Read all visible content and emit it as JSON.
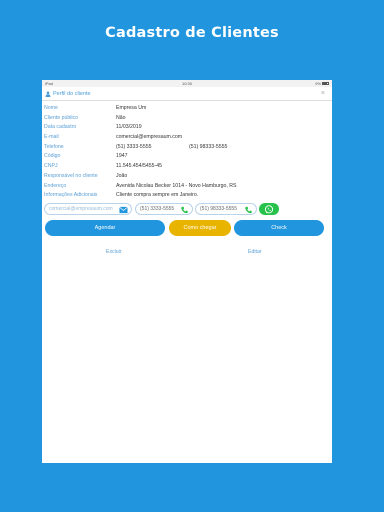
{
  "headline": "Cadastro de Clientes",
  "status_bar": {
    "carrier": "iPad",
    "time": "10:30",
    "battery": "9%"
  },
  "modal": {
    "title": "Perfil do cliente",
    "close_glyph": "×"
  },
  "fields": [
    {
      "label": "Nome",
      "value": "Empresa Um"
    },
    {
      "label": "Cliente público",
      "value": "Não"
    },
    {
      "label": "Data cadastro",
      "value": "11/03/2019"
    },
    {
      "label": "E-mail",
      "value": "comercial@empresaum.com"
    },
    {
      "label": "Telefone",
      "value": "(51) 3333-5555",
      "value2": "(51) 98333-5555"
    },
    {
      "label": "Código",
      "value": "1947"
    },
    {
      "label": "CNPJ",
      "value": "11.545.454/5455-45"
    },
    {
      "label": "Responsável no cliente",
      "value": "João"
    },
    {
      "label": "Endereço",
      "value": "Avenida Nicolau Becker 1014 - Novo Hamburgo, RS"
    },
    {
      "label": "Informações Adicionais",
      "value": "Cliente compra sempre em Janeiro."
    }
  ],
  "contacts": {
    "email": "comercial@empresaum.com",
    "phone1": "(51) 3333-5555",
    "phone2": "(51) 98333-5555"
  },
  "actions": {
    "agendar": "Agendar",
    "como_chegar": "Como chegar",
    "check": "Check"
  },
  "links": {
    "excluir": "Excluir",
    "editar": "Editar"
  },
  "colors": {
    "background": "#2196de",
    "primary": "#2196de",
    "secondary": "#e8b400",
    "whatsapp": "#27c24c",
    "label": "#5a9fd6"
  }
}
